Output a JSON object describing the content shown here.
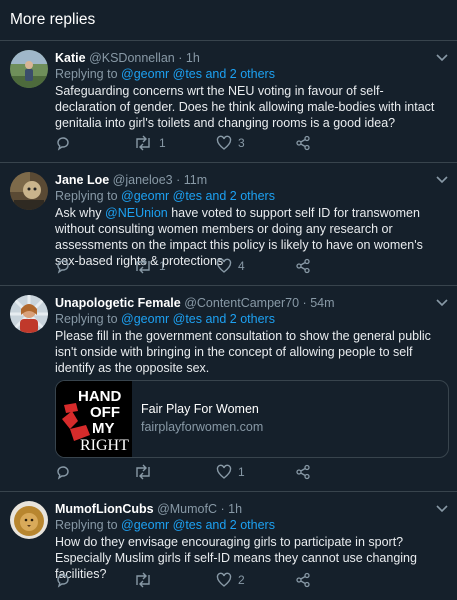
{
  "header": {
    "title": "More replies"
  },
  "colors": {
    "background": "#15202b",
    "link": "#1da1f2",
    "muted": "#8899a6",
    "divider": "#38444d"
  },
  "tweets": [
    {
      "name": "Katie",
      "handle": "@KSDonnellan",
      "time": "1h",
      "replying_prefix": "Replying to",
      "replying_links": "@geomr @tes and 2 others",
      "text": "Safeguarding concerns wrt the NEU voting in favour of self-declaration of gender.  Does he think allowing male-bodies with intact genitalia into girl's toilets and changing rooms is a good idea?",
      "retweets": "1",
      "likes": "3",
      "avatar_icon": "avatar-photo"
    },
    {
      "name": "Jane Loe",
      "handle": "@janeloe3",
      "time": "11m",
      "replying_prefix": "Replying to",
      "replying_links": "@geomr @tes and 2 others",
      "text_before": "Ask why ",
      "text_mention": "@NEUnion",
      "text_after": "  have voted to support self ID for transwomen without consulting women members or doing any research or assessments on the impact this policy is likely to have on women's sex-based rights & protections",
      "retweets": "1",
      "likes": "4",
      "avatar_icon": "avatar-photo"
    },
    {
      "name": "Unapologetic Female",
      "handle": "@ContentCamper70",
      "time": "54m",
      "replying_prefix": "Replying to",
      "replying_links": "@geomr @tes and 2 others",
      "text": "Please fill in the government consultation to show the general public isn't onside with bringing in the concept of allowing people to self identify as the opposite sex.",
      "card": {
        "logo_lines": [
          "HAND",
          "OFF",
          "MY",
          "RIGHT"
        ],
        "title": "Fair Play For Women",
        "domain": "fairplayforwomen.com"
      },
      "retweets": "",
      "likes": "1",
      "avatar_icon": "avatar-photo"
    },
    {
      "name": "MumofLionCubs",
      "handle": "@MumofC",
      "time": "1h",
      "replying_prefix": "Replying to",
      "replying_links": "@geomr @tes and 2 others",
      "text": "How do they envisage encouraging girls to participate in sport? Especially Muslim girls if self-ID means they cannot use changing facilities?",
      "retweets": "",
      "likes": "2",
      "avatar_icon": "lion-avatar"
    }
  ]
}
